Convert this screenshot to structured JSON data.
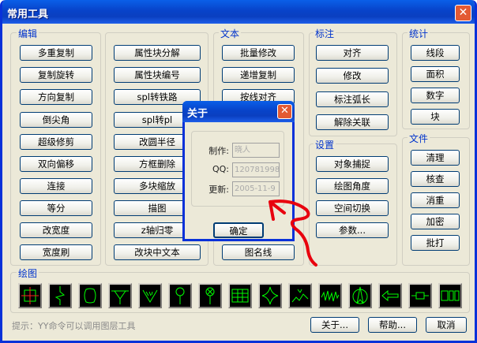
{
  "window": {
    "title": "常用工具",
    "close_glyph": "✕"
  },
  "groups": {
    "edit": "编辑",
    "text": "文本",
    "annot": "标注",
    "stats": "统计",
    "settings": "设置",
    "file": "文件",
    "draw": "绘图"
  },
  "edit_col1": [
    "多重复制",
    "复制旋转",
    "方向复制",
    "倒尖角",
    "超级修剪",
    "双向偏移",
    "连接",
    "等分",
    "改宽度",
    "宽度刷"
  ],
  "edit_col2": [
    "属性块分解",
    "属性块编号",
    "spl转铁路",
    "spl转pl",
    "改圆半径",
    "方框删除",
    "多块缩放",
    "描图",
    "z轴归零",
    "改块中文本"
  ],
  "text_col": [
    "批量修改",
    "递增复制",
    "按线对齐",
    "图名线"
  ],
  "annot_col": [
    "对齐",
    "修改",
    "标注弧长",
    "解除关联"
  ],
  "settings_col": [
    "对象捕捉",
    "绘图角度",
    "空间切换",
    "参数..."
  ],
  "stats_col": [
    "线段",
    "面积",
    "数字",
    "块"
  ],
  "file_col": [
    "清理",
    "核查",
    "消重",
    "加密",
    "批打"
  ],
  "draw_icons": [
    "crosshair-square-icon",
    "zigzag-line-icon",
    "rounded-shape-icon",
    "triangle-hatch-icon",
    "chevron-hatch-icon",
    "circle-pin-icon",
    "circle-x-pin-icon",
    "grid-table-icon",
    "star-shape-icon",
    "tilde-line-icon",
    "wave-line-icon",
    "north-arrow-icon",
    "left-arrow-icon",
    "resistor-icon",
    "segment-display-icon",
    "spiral-icon"
  ],
  "hint": "提示：YY命令可以调用图层工具",
  "bottom_buttons": {
    "about": "关于...",
    "help": "帮助...",
    "cancel": "取消"
  },
  "about_dialog": {
    "title": "关于",
    "close_glyph": "✕",
    "fields": [
      {
        "label": "制作:",
        "value": "晓人"
      },
      {
        "label": "QQ:",
        "value": "120781998"
      },
      {
        "label": "更新:",
        "value": "2005-11-9"
      }
    ],
    "ok": "确定"
  },
  "colors": {
    "title_blue": "#0a4ad6",
    "group_label": "#0033cc",
    "icon_green": "#00ff00",
    "annotation_red": "#e8000e"
  }
}
